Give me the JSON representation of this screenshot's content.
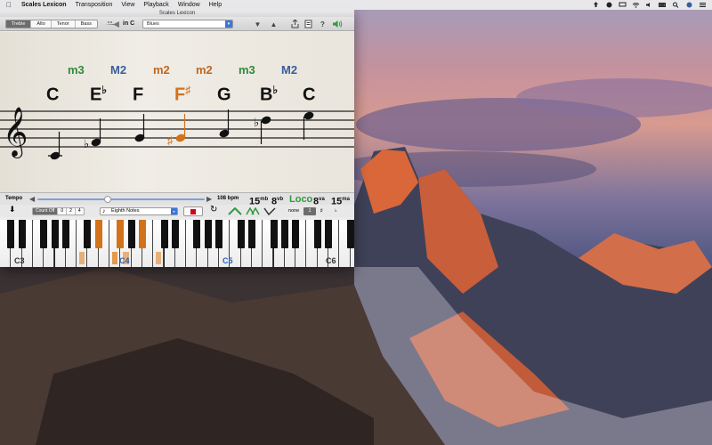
{
  "menubar": {
    "apple_icon": "apple-icon",
    "app_name": "Scales Lexicon",
    "items": [
      "Transposition",
      "View",
      "Playback",
      "Window",
      "Help"
    ]
  },
  "window": {
    "title": "Scales Lexicon",
    "clef_options": [
      "Treble",
      "Alto",
      "Tenor",
      "Bass"
    ],
    "clef_selected": "Treble",
    "key_label": "in C",
    "scale_value": "Blues",
    "accent_color": "#3b78d8"
  },
  "score": {
    "intervals": [
      {
        "label": "m3",
        "color": "#2f8a3c"
      },
      {
        "label": "M2",
        "color": "#3a5d9c"
      },
      {
        "label": "m2",
        "color": "#c0661c"
      },
      {
        "label": "m2",
        "color": "#c0661c"
      },
      {
        "label": "m3",
        "color": "#2f8a3c"
      },
      {
        "label": "M2",
        "color": "#3a5d9c"
      }
    ],
    "notes": [
      {
        "name": "C",
        "acc": "",
        "color": "#111111"
      },
      {
        "name": "E",
        "acc": "♭",
        "color": "#111111"
      },
      {
        "name": "F",
        "acc": "",
        "color": "#111111"
      },
      {
        "name": "F",
        "acc": "♯",
        "color": "#d2721a"
      },
      {
        "name": "G",
        "acc": "",
        "color": "#111111"
      },
      {
        "name": "B",
        "acc": "♭",
        "color": "#111111"
      },
      {
        "name": "C",
        "acc": "",
        "color": "#111111"
      }
    ]
  },
  "tempo": {
    "label": "Tempo",
    "bpm": "108 bpm",
    "slider_fraction": 0.42,
    "octave_buttons": [
      {
        "main": "15",
        "sup": "mb",
        "color": "#111111"
      },
      {
        "main": "8",
        "sup": "vb",
        "color": "#111111"
      },
      {
        "main": "Loco",
        "sup": "",
        "color": "#2f9a3c"
      },
      {
        "main": "8",
        "sup": "va",
        "color": "#111111"
      },
      {
        "main": "15",
        "sup": "ma",
        "color": "#111111"
      }
    ]
  },
  "controls": {
    "count_label": "Count Off",
    "count_options": [
      "0",
      "2",
      "4"
    ],
    "count_selected": "0",
    "note_value": "Eighth Notes",
    "accidental_label": "none",
    "accidental_value": "1"
  },
  "piano": {
    "labels": [
      "C3",
      "C4",
      "C5",
      "C6"
    ]
  }
}
